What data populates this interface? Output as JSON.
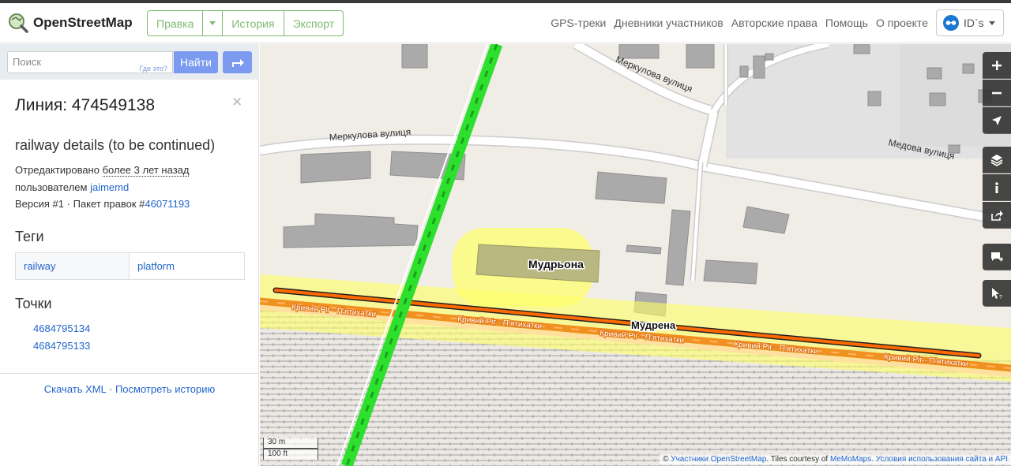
{
  "header": {
    "logo_text": "OpenStreetMap",
    "edit_label": "Правка",
    "history_label": "История",
    "export_label": "Экспорт",
    "nav": [
      "GPS-треки",
      "Дневники участников",
      "Авторские права",
      "Помощь",
      "О проекте"
    ],
    "user_label": "ID`s"
  },
  "search": {
    "placeholder": "Поиск",
    "where_is": "Где это?",
    "button": "Найти"
  },
  "feature": {
    "title": "Линия: 474549138",
    "comment": "railway details (to be continued)",
    "edited_prefix": "Отредактировано",
    "edited_time": "более 3 лет назад",
    "user_prefix": "пользователем",
    "user": "jaimemd",
    "version": "Версия #1",
    "changeset_prefix": "Пакет правок #",
    "changeset": "46071193",
    "tags_heading": "Теги",
    "tag_key": "railway",
    "tag_value": "platform",
    "nodes_heading": "Точки",
    "nodes": [
      "4684795134",
      "4684795133"
    ],
    "download_xml": "Скачать XML",
    "view_history": "Посмотреть историю",
    "separator": "·"
  },
  "map": {
    "streets": {
      "merkulova_1": "Меркулова вулиця",
      "merkulova_2": "Меркулова вулиця",
      "medova": "Медова вулиця"
    },
    "place_labels": {
      "station": "Мудрьона",
      "platform": "Мудрена"
    },
    "route_label": "Кривий Ріг - П'ятихатки",
    "scale_metric": "30 m",
    "scale_imperial": "100 ft",
    "attribution": {
      "copy": "©",
      "contributors": "Участники",
      "osm": "OpenStreetMap",
      "tiles": ". Tiles courtesy of",
      "memomaps": "MeMoMaps",
      "terms": ". Условия использования сайта и API"
    },
    "colors": {
      "highlight": "#ff6a00",
      "platform_halo": "#ffff66",
      "railway_green": "#2ee02e",
      "route_orange": "#f09020"
    }
  }
}
